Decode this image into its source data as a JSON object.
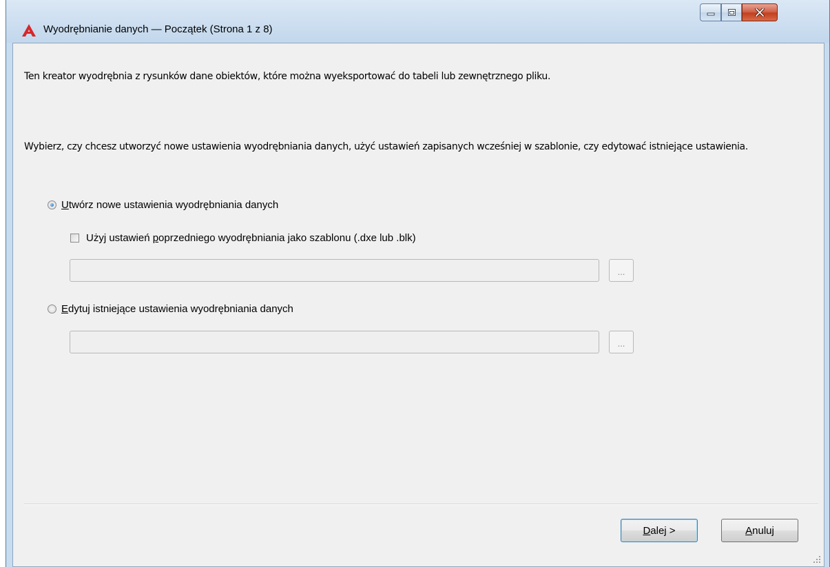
{
  "window": {
    "title": "Wyodrębnianie danych — Początek (Strona 1 z 8)",
    "icon": "autocad-logo-icon",
    "controls": {
      "minimize_icon": "minimize-icon",
      "maximize_icon": "maximize-icon",
      "close_icon": "close-icon"
    }
  },
  "intro_text": "Ten kreator wyodrębnia z rysunków dane obiektów, które można wyeksportować do tabeli lub zewnętrznego pliku.",
  "description": "Wybierz, czy chcesz utworzyć nowe ustawienia wyodrębniania danych, użyć ustawień zapisanych wcześniej w szablonie, czy edytować istniejące ustawienia.",
  "options": {
    "create_new": {
      "accel": "U",
      "label_rest": "twórz nowe ustawienia wyodrębniania danych",
      "selected": true
    },
    "use_template": {
      "label_before": "Użyj ustawień ",
      "accel": "p",
      "label_after": "oprzedniego wyodrębniania jako szablonu (.dxe lub .blk)",
      "checked": false,
      "path_value": "",
      "browse_label": "..."
    },
    "edit_existing": {
      "accel": "E",
      "label_rest": "dytuj istniejące ustawienia wyodrębniania danych",
      "selected": false,
      "path_value": "",
      "browse_label": "..."
    }
  },
  "buttons": {
    "next": {
      "accel": "D",
      "label_rest": "alej >"
    },
    "cancel": {
      "accel": "A",
      "label_rest": "nuluj"
    }
  },
  "colors": {
    "accent": "#d7272b",
    "close_button": "#c2401f",
    "titlebar": "#c7dcef"
  }
}
